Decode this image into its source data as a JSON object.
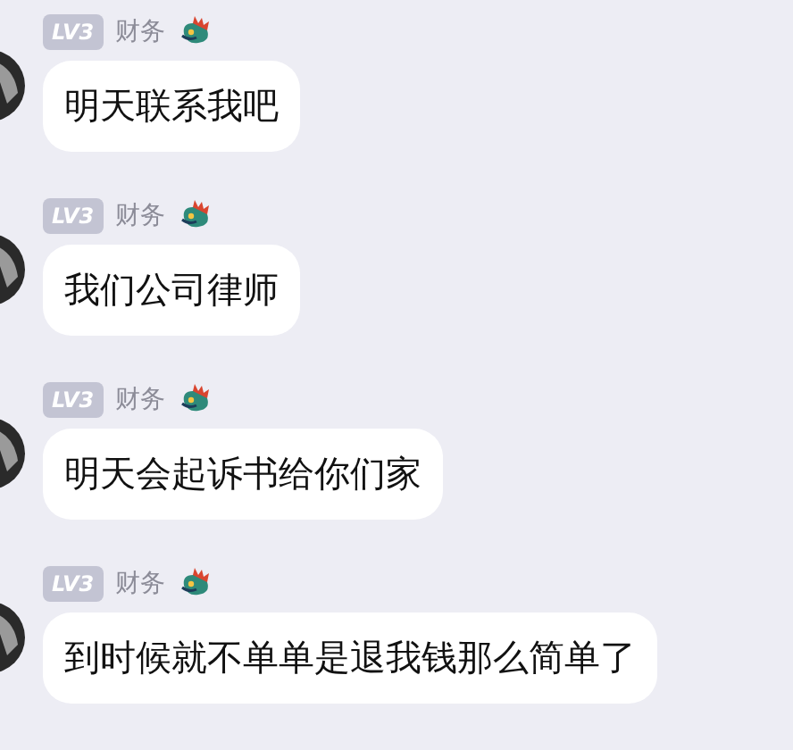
{
  "messages": [
    {
      "badge": "LV3",
      "sender": "财务",
      "text": "明天联系我吧"
    },
    {
      "badge": "LV3",
      "sender": "财务",
      "text": "我们公司律师"
    },
    {
      "badge": "LV3",
      "sender": "财务",
      "text": "明天会起诉书给你们家"
    },
    {
      "badge": "LV3",
      "sender": "财务",
      "text": "到时候就不单单是退我钱那么简单了"
    }
  ]
}
